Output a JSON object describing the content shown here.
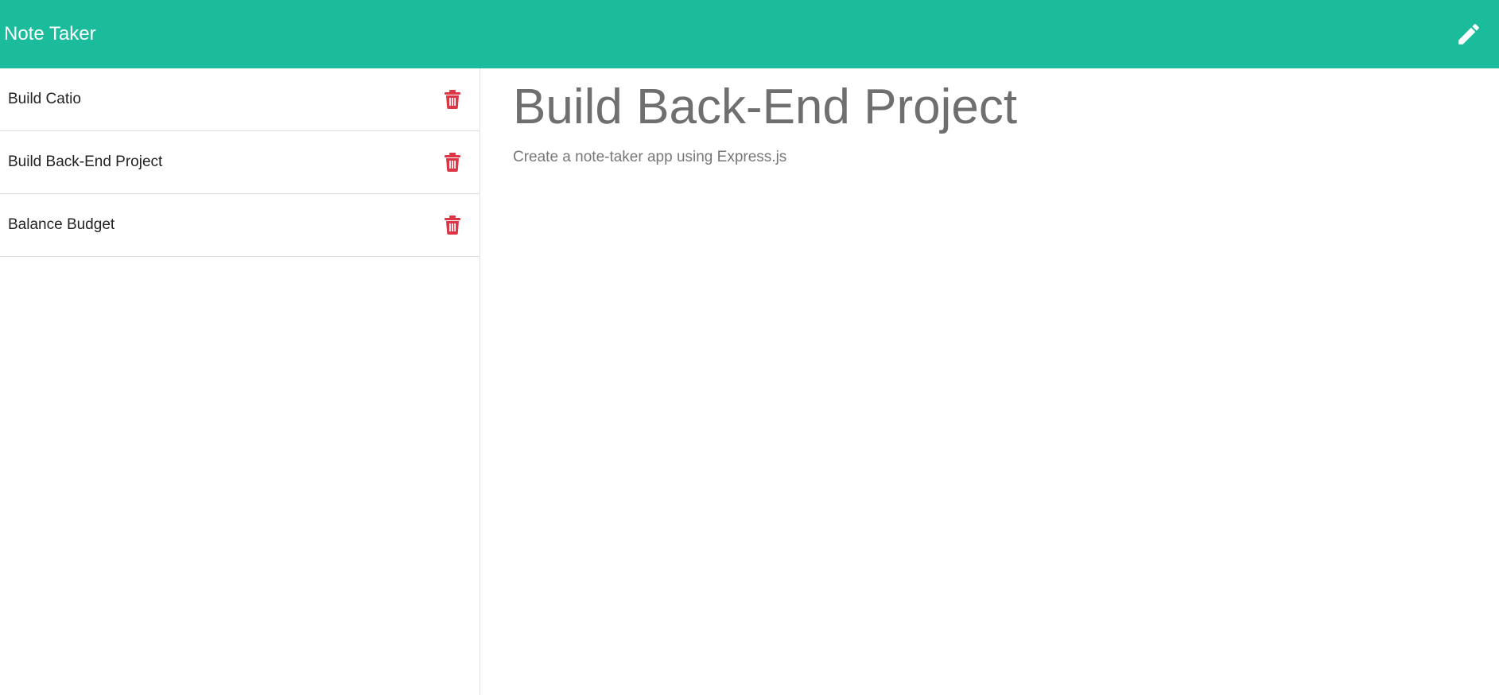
{
  "navbar": {
    "brand": "Note Taker",
    "new_note_icon": "pencil-icon",
    "color": "#1abc9c"
  },
  "sidebar": {
    "notes": [
      {
        "title": "Build Catio",
        "delete_icon": "trash-icon"
      },
      {
        "title": "Build Back-End Project",
        "delete_icon": "trash-icon"
      },
      {
        "title": "Balance Budget",
        "delete_icon": "trash-icon"
      }
    ],
    "delete_color": "#dc3545"
  },
  "main": {
    "note_title": "Build Back-End Project",
    "note_text": "Create a note-taker app using Express.js"
  }
}
